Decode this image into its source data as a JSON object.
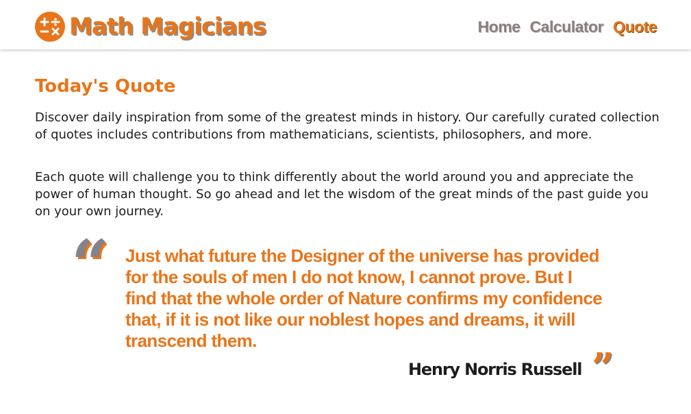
{
  "header": {
    "logo_icon": "math-operators-icon",
    "brand_title": "Math Magicians",
    "nav": [
      {
        "label": "Home",
        "active": false
      },
      {
        "label": "Calculator",
        "active": false
      },
      {
        "label": "Quote",
        "active": true
      }
    ]
  },
  "main": {
    "title": "Today's Quote",
    "paragraphs": [
      "Discover daily inspiration from some of the greatest minds in history. Our carefully curated collection of quotes includes contributions from mathematicians, scientists, philosophers, and more.",
      "Each quote will challenge you to think differently about the world around you and appreciate the power of human thought. So go ahead and let the wisdom of the great minds of the past guide you on your own journey."
    ],
    "quote": {
      "open_mark": "“",
      "text": "Just what future the Designer of the universe has provided for the souls of men I do not know, I cannot prove. But I find that the whole order of Nature confirms my confidence that, if it is not like our noblest hopes and dreams, it will transcend them.",
      "author": "Henry Norris Russell",
      "close_mark": "”"
    }
  },
  "colors": {
    "accent": "#e8751a",
    "nav_inactive": "#8a7e7e",
    "quote_mark_gray": "#84828b",
    "text": "#1d1d1d"
  }
}
